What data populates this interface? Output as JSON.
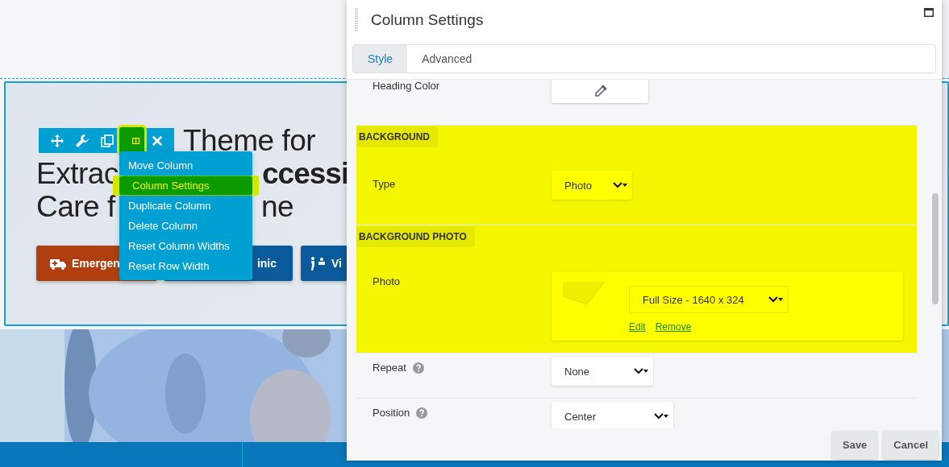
{
  "hero": {
    "heading": [
      [
        {
          "text": "Theme for",
          "bold": false
        }
      ],
      [
        {
          "text": "Extrac",
          "bold": false
        },
        {
          "text": "ccessi",
          "bold": true
        }
      ],
      [
        {
          "text": "Care f",
          "bold": false
        },
        {
          "text": "ne",
          "bold": false
        }
      ]
    ],
    "buttons": [
      {
        "label": "Emergen",
        "kind": "emergency"
      },
      {
        "label": "inic",
        "kind": "clinic"
      },
      {
        "label": "Vi",
        "kind": "visit"
      }
    ]
  },
  "toolbar": [
    {
      "kind": "move",
      "selected": false
    },
    {
      "kind": "settings",
      "selected": false
    },
    {
      "kind": "duplicate",
      "selected": false
    },
    {
      "kind": "columns",
      "selected": true
    },
    {
      "kind": "remove",
      "selected": false
    }
  ],
  "menu": [
    {
      "label": "Move Column",
      "selected": false
    },
    {
      "label": "Column Settings",
      "selected": true
    },
    {
      "label": "Duplicate Column",
      "selected": false
    },
    {
      "label": "Delete Column",
      "selected": false
    },
    {
      "label": "Reset Column Widths",
      "selected": false
    },
    {
      "label": "Reset Row Width",
      "selected": false
    }
  ],
  "panel": {
    "title": "Column Settings",
    "tabs": [
      {
        "label": "Style",
        "selected": true
      },
      {
        "label": "Advanced",
        "selected": false
      }
    ],
    "rows": [
      {
        "kind": "field",
        "label": "Heading Color",
        "help": false,
        "highlighted": false,
        "control": {
          "kind": "color"
        }
      },
      {
        "kind": "heading",
        "label": "BACKGROUND",
        "highlighted": true
      },
      {
        "kind": "field",
        "label": "Type",
        "help": false,
        "highlighted": true,
        "control": {
          "kind": "select",
          "value": "Photo"
        }
      },
      {
        "kind": "heading",
        "label": "BACKGROUND PHOTO",
        "highlighted": true
      },
      {
        "kind": "field",
        "label": "Photo",
        "help": false,
        "highlighted": true,
        "control": {
          "value": "Full Size - 1640 x 324",
          "links": [
            "Edit",
            "Remove"
          ]
        }
      },
      {
        "kind": "field",
        "label": "Repeat",
        "help": true,
        "highlighted": false,
        "control": {
          "kind": "select",
          "value": "None"
        }
      },
      {
        "kind": "field",
        "label": "Position",
        "help": true,
        "highlighted": false,
        "control": {
          "kind": "select",
          "value": "Center"
        }
      }
    ],
    "buttons": [
      "Save",
      "Cancel"
    ]
  }
}
